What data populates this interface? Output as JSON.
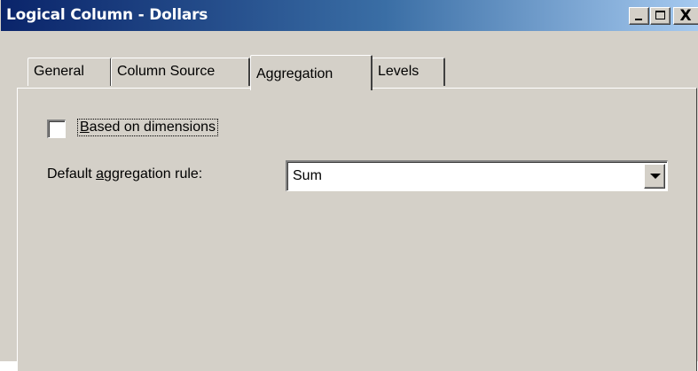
{
  "window": {
    "title": "Logical Column - Dollars",
    "close_glyph": "X"
  },
  "tabs": [
    {
      "label": "General"
    },
    {
      "label": "Column Source"
    },
    {
      "label": "Aggregation",
      "selected": true
    },
    {
      "label": "Levels"
    }
  ],
  "aggregation": {
    "based_on_dimensions": {
      "label_prefix": "",
      "label_mnemonic": "B",
      "label_rest": "ased on dimensions",
      "checked": false
    },
    "default_rule": {
      "label_prefix": "Default ",
      "label_mnemonic": "a",
      "label_rest": "ggregation rule:",
      "value": "Sum"
    }
  },
  "icons": {
    "minimize": "minimize-icon",
    "maximize": "maximize-icon",
    "close": "close-icon",
    "dropdown": "chevron-down-icon"
  },
  "colors": {
    "titlebar_start": "#0a246a",
    "titlebar_end": "#a6caf0",
    "face": "#d4d0c8"
  }
}
